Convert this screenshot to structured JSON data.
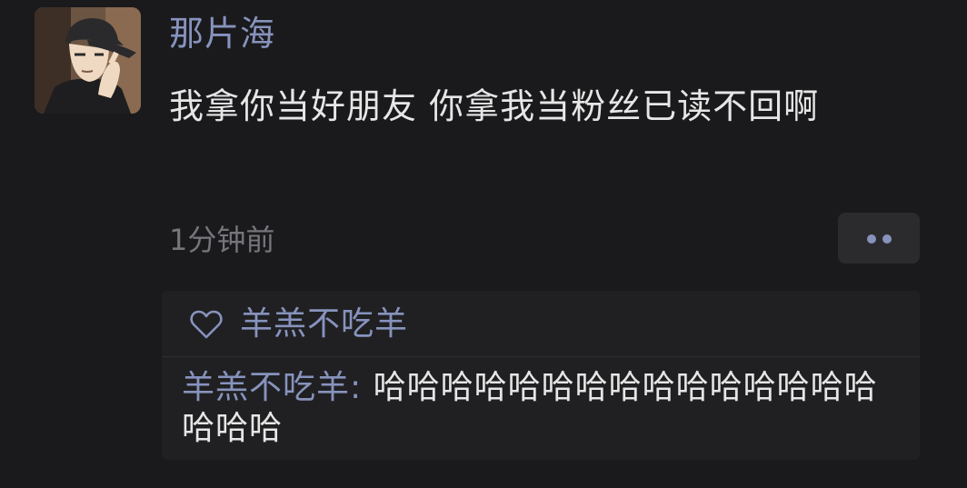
{
  "post": {
    "author": "那片海",
    "text": "我拿你当好朋友 你拿我当粉丝已读不回啊",
    "time": "1分钟前",
    "more_icon": "more-dots-icon"
  },
  "likes": {
    "icon": "heart-outline-icon",
    "names": "羊羔不吃羊"
  },
  "comments": [
    {
      "author": "羊羔不吃羊",
      "separator": ": ",
      "text": "哈哈哈哈哈哈哈哈哈哈哈哈哈哈哈哈哈哈"
    }
  ],
  "colors": {
    "background": "#1a1a1c",
    "name_blue": "#8793bd",
    "text": "#e6e6e6",
    "muted": "#75757a",
    "panel": "#202022"
  }
}
